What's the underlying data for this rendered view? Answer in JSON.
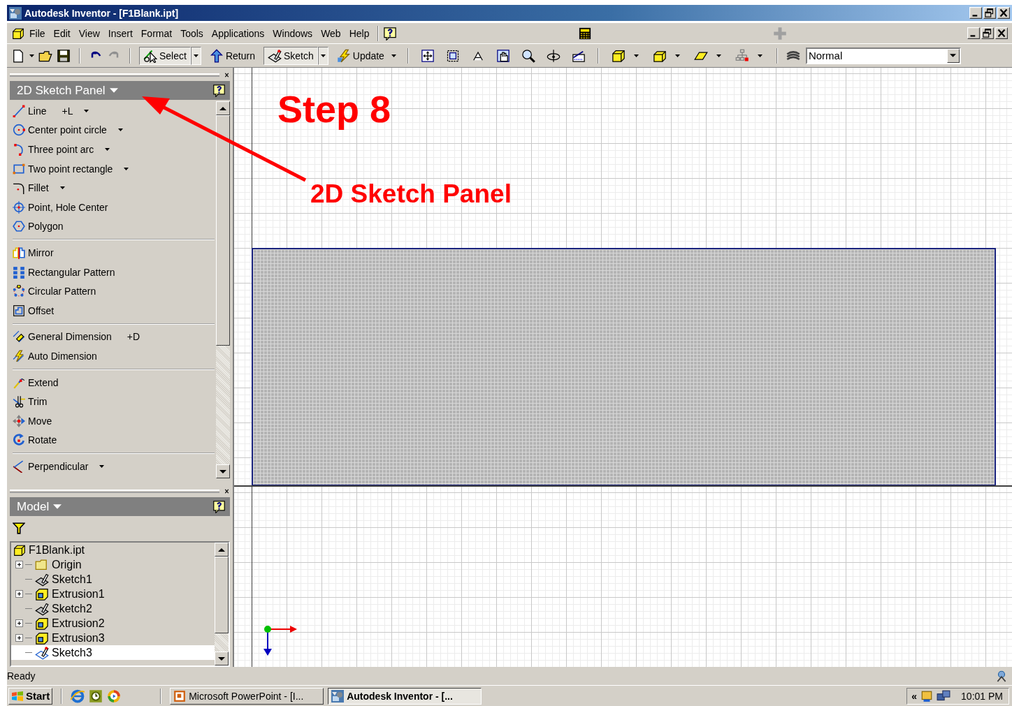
{
  "window": {
    "title": "Autodesk Inventor - [F1Blank.ipt]"
  },
  "menu": [
    "File",
    "Edit",
    "View",
    "Insert",
    "Format",
    "Tools",
    "Applications",
    "Windows",
    "Web",
    "Help"
  ],
  "toolbar": {
    "text_buttons": [
      {
        "label": "Select",
        "pressed": true,
        "dropdown": true
      },
      {
        "label": "Return",
        "pressed": false,
        "dropdown": false
      },
      {
        "label": "Sketch",
        "pressed": true,
        "dropdown": true
      },
      {
        "label": "Update",
        "pressed": false,
        "dropdown": true
      }
    ],
    "style_value": "Normal"
  },
  "sketch_panel": {
    "title": "2D Sketch Panel",
    "groups": [
      {
        "items": [
          {
            "label": "Line",
            "shortcut": "+L",
            "dropdown": true
          },
          {
            "label": "Center point circle",
            "dropdown": true
          },
          {
            "label": "Three point arc",
            "dropdown": true
          },
          {
            "label": "Two point rectangle",
            "dropdown": true
          },
          {
            "label": "Fillet",
            "dropdown": true
          },
          {
            "label": "Point, Hole Center",
            "dropdown": false
          },
          {
            "label": "Polygon",
            "dropdown": false
          }
        ]
      },
      {
        "items": [
          {
            "label": "Mirror",
            "dropdown": false
          },
          {
            "label": "Rectangular Pattern",
            "dropdown": false
          },
          {
            "label": "Circular Pattern",
            "dropdown": false
          },
          {
            "label": "Offset",
            "dropdown": false
          }
        ]
      },
      {
        "items": [
          {
            "label": "General Dimension",
            "shortcut": "+D",
            "dropdown": false
          },
          {
            "label": "Auto Dimension",
            "dropdown": false
          }
        ]
      },
      {
        "items": [
          {
            "label": "Extend",
            "dropdown": false
          },
          {
            "label": "Trim",
            "dropdown": false
          },
          {
            "label": "Move",
            "dropdown": false
          },
          {
            "label": "Rotate",
            "dropdown": false
          }
        ]
      },
      {
        "items": [
          {
            "label": "Perpendicular",
            "dropdown": true
          }
        ]
      }
    ]
  },
  "model_browser": {
    "title": "Model",
    "tree": {
      "label": "F1Blank.ipt",
      "selected": false,
      "children": [
        {
          "label": "Origin",
          "expandable": true,
          "selected": false
        },
        {
          "label": "Sketch1",
          "expandable": false,
          "selected": false
        },
        {
          "label": "Extrusion1",
          "expandable": true,
          "selected": false
        },
        {
          "label": "Sketch2",
          "expandable": false,
          "selected": false
        },
        {
          "label": "Extrusion2",
          "expandable": true,
          "selected": false
        },
        {
          "label": "Extrusion3",
          "expandable": true,
          "selected": false
        },
        {
          "label": "Sketch3",
          "expandable": false,
          "selected": true
        }
      ]
    }
  },
  "annotations": {
    "step": "Step 8",
    "callout": "2D Sketch Panel"
  },
  "status_bar": {
    "text": "Ready"
  },
  "taskbar": {
    "start": "Start",
    "tasks": [
      {
        "label": "Microsoft PowerPoint - [I...",
        "active": false
      },
      {
        "label": "Autodesk Inventor - [...",
        "active": true
      }
    ],
    "tray_chevron": "«",
    "clock": "10:01 PM"
  }
}
